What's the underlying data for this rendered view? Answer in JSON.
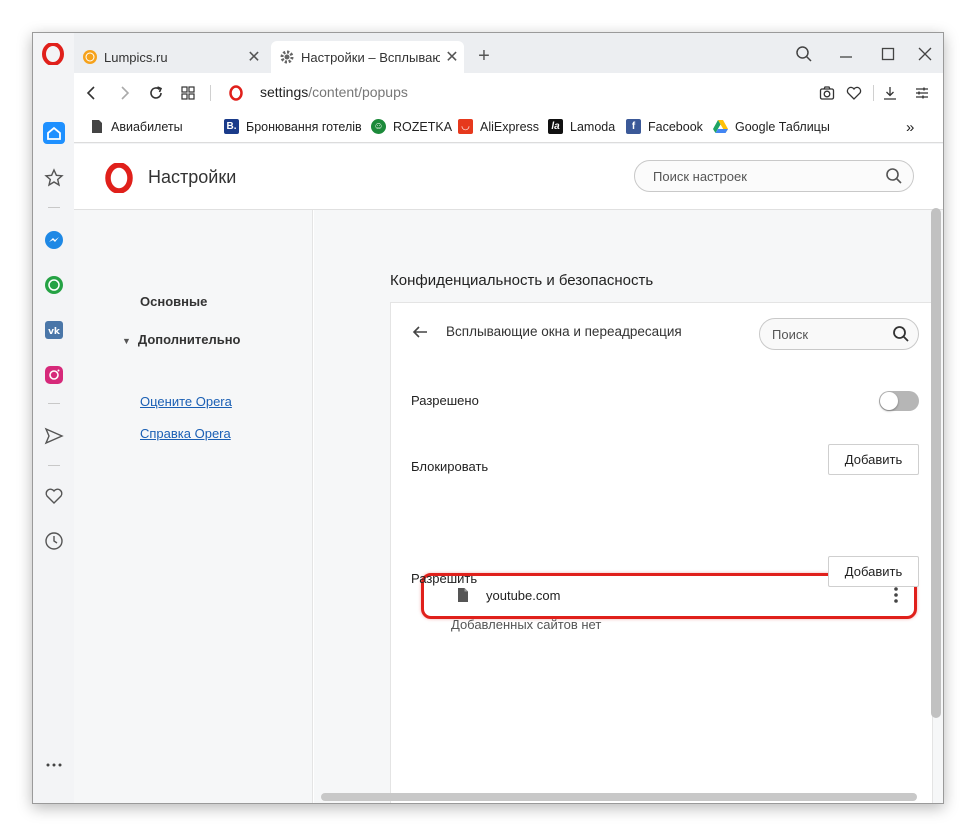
{
  "tabs": [
    {
      "title": "Lumpics.ru",
      "active": false
    },
    {
      "title": "Настройки – Всплывающие окна и переадресация",
      "active": true
    }
  ],
  "address": {
    "scheme_host": "settings",
    "path": "/content/popups"
  },
  "bookmarks": [
    {
      "label": "Авиабилеты",
      "icon": "document-icon",
      "color": "#444444"
    },
    {
      "label": "Бронювання готелів",
      "icon": "booking-icon",
      "color": "#1a3b8a"
    },
    {
      "label": "ROZETKA",
      "icon": "rozetka-icon",
      "color": "#1c8a3a"
    },
    {
      "label": "AliExpress",
      "icon": "aliexpress-icon",
      "color": "#e6391d"
    },
    {
      "label": "Lamoda",
      "icon": "lamoda-icon",
      "color": "#111111"
    },
    {
      "label": "Facebook",
      "icon": "facebook-icon",
      "color": "#3b5998"
    },
    {
      "label": "Google Таблицы",
      "icon": "google-drive-icon",
      "color": "#1fa463"
    }
  ],
  "settings": {
    "title": "Настройки",
    "search_placeholder": "Поиск настроек",
    "nav": {
      "basic": "Основные",
      "advanced": "Дополнительно",
      "rate": "Оцените Opera",
      "help": "Справка Opera"
    },
    "section_title": "Конфиденциальность и безопасность",
    "popups": {
      "title": "Всплывающие окна и переадресация",
      "search_placeholder": "Поиск",
      "allowed_label": "Разрешено",
      "allowed_toggle_on": false,
      "block_label": "Блокировать",
      "block_add": "Добавить",
      "blocked_site": "youtube.com",
      "allow_label": "Разрешить",
      "allow_add": "Добавить",
      "allow_empty": "Добавленных сайтов нет"
    }
  },
  "colors": {
    "opera_red": "#e0201b",
    "highlight_red": "#e0201b",
    "sidebar_blue": "#1e90ff"
  }
}
